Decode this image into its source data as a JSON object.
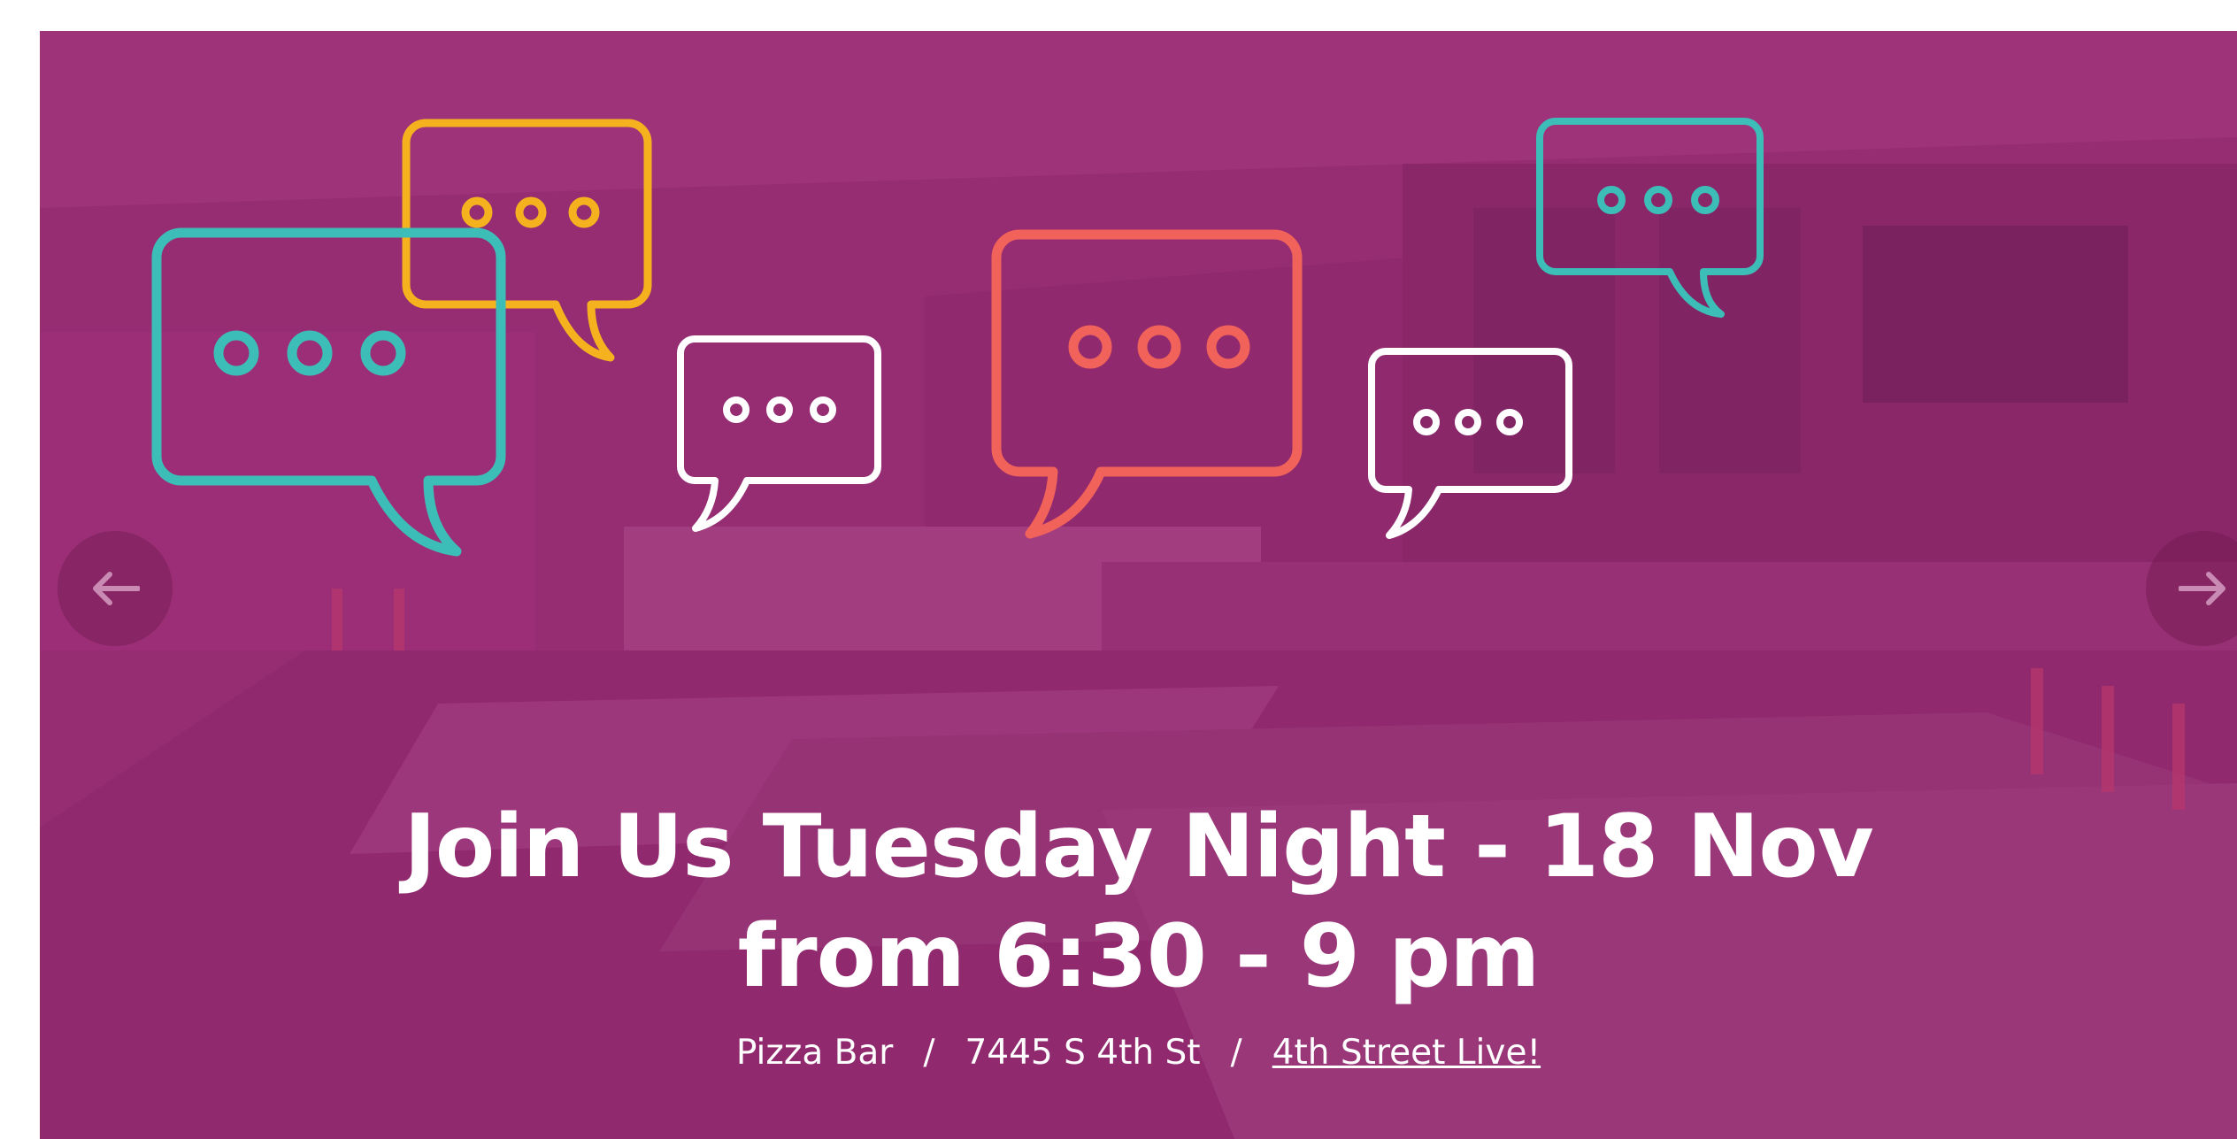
{
  "hero": {
    "headline_line1": "Join Us Tuesday Night - 18 Nov",
    "headline_line2": "from 6:30 - 9 pm",
    "venue": "Pizza Bar",
    "separator": "/",
    "address": "7445 S 4th St",
    "link_text": "4th Street Live!"
  },
  "icons": {
    "prev": "arrow-left-icon",
    "next": "arrow-right-icon",
    "bubbles": "speech-bubble-icon"
  },
  "colors": {
    "overlay": "#a02d78",
    "teal": "#3dbdb7",
    "yellow": "#f6b21e",
    "coral": "#f0625a",
    "white": "#ffffff"
  }
}
